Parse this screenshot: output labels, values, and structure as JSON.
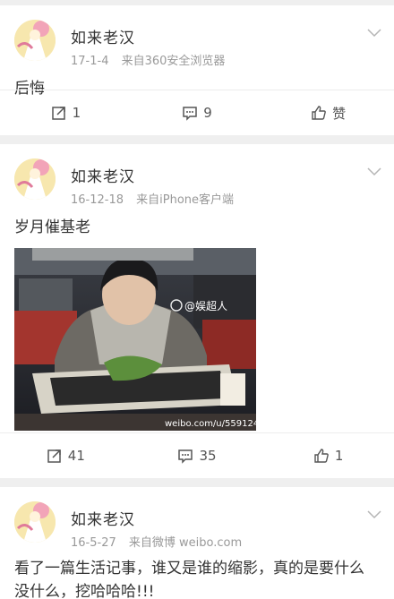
{
  "posts": [
    {
      "username": "如来老汉",
      "date": "17-1-4",
      "source": "来自360安全浏览器",
      "text": "后悔",
      "actions": {
        "repost": "1",
        "comment": "9",
        "like": "赞"
      }
    },
    {
      "username": "如来老汉",
      "date": "16-12-18",
      "source": "来自iPhone客户端",
      "text": "岁月催基老",
      "image": {
        "watermark_handle": "@娱超人",
        "watermark_url": "weibo.com/u/559124"
      },
      "actions": {
        "repost": "41",
        "comment": "35",
        "like": "1"
      }
    },
    {
      "username": "如来老汉",
      "date": "16-5-27",
      "source": "来自微博 weibo.com",
      "text": "看了一篇生活记事，谁又是谁的缩影，真的是要什么没什么，挖哈哈哈!!!"
    }
  ],
  "icons": {
    "repost": "repost-icon",
    "comment": "comment-icon",
    "like": "thumbs-up-icon",
    "menu": "chevron-down-icon"
  },
  "colors": {
    "background": "#efefef",
    "card": "#ffffff",
    "meta_text": "#999999",
    "body_text": "#333333"
  }
}
